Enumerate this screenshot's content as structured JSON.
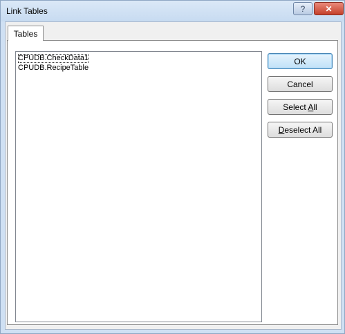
{
  "window": {
    "title": "Link Tables",
    "help_label": "?",
    "close_label": "✕"
  },
  "tabs": [
    {
      "label": "Tables"
    }
  ],
  "table_list": {
    "items": [
      {
        "label": "CPUDB.CheckData1"
      },
      {
        "label": "CPUDB.RecipeTable"
      }
    ]
  },
  "buttons": {
    "ok": "OK",
    "cancel": "Cancel",
    "select_all_prefix": "Select ",
    "select_all_mnemonic": "A",
    "select_all_suffix": "ll",
    "deselect_all_prefix": "",
    "deselect_all_mnemonic": "D",
    "deselect_all_suffix": "eselect All"
  },
  "colors": {
    "frame": "#cfe0f3",
    "default_button_border": "#3c7fb1",
    "close_button": "#c5402a"
  }
}
